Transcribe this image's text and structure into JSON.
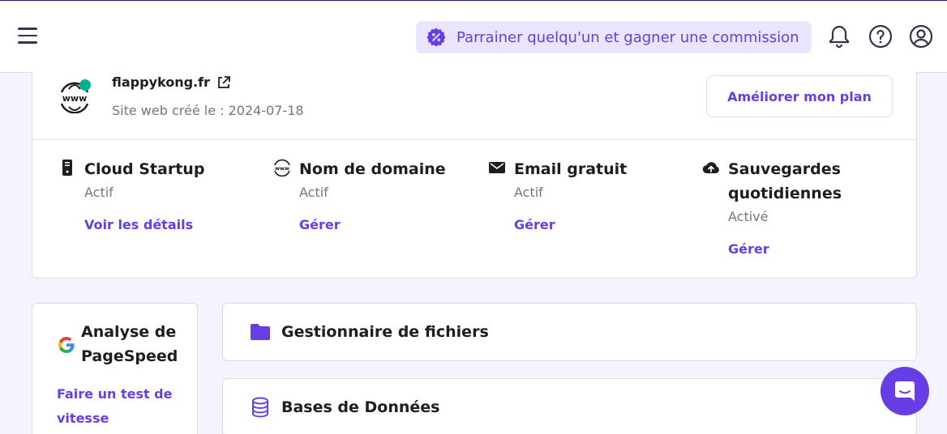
{
  "colors": {
    "accent": "#673de6",
    "accent_light": "#ebe4ff",
    "page_bg": "#f4f4ff",
    "text_primary": "#1d1e20",
    "text_muted": "#727586",
    "status_online": "#00b090"
  },
  "topbar": {
    "menu_icon": "hamburger-icon",
    "referral": {
      "icon": "discount-badge-icon",
      "label": "Parrainer quelqu'un et gagner une commission"
    },
    "icons": [
      "bell-icon",
      "help-circle-icon",
      "user-circle-icon"
    ]
  },
  "site": {
    "logo_icon": "www-globe-icon",
    "domain": "flappykong.fr",
    "external_icon": "external-link-icon",
    "created": "Site web créé le : 2024-07-18",
    "upgrade_label": "Améliorer mon plan"
  },
  "services": [
    {
      "icon": "server-icon",
      "title": "Cloud Startup",
      "status": "Actif",
      "link": "Voir les détails"
    },
    {
      "icon": "www-icon",
      "title": "Nom de domaine",
      "status": "Actif",
      "link": "Gérer"
    },
    {
      "icon": "envelope-icon",
      "title": "Email gratuit",
      "status": "Actif",
      "link": "Gérer"
    },
    {
      "icon": "cloud-upload-icon",
      "title": "Sauvegardes quotidiennes",
      "status": "Activé",
      "link": "Gérer"
    }
  ],
  "pagespeed": {
    "icon": "google-icon",
    "title": "Analyse de PageSpeed",
    "link": "Faire un test de vitesse"
  },
  "tools": [
    {
      "icon": "folder-icon",
      "label": "Gestionnaire de fichiers"
    },
    {
      "icon": "database-icon",
      "label": "Bases de Données"
    }
  ],
  "chat": {
    "icon": "chat-bubble-icon"
  }
}
